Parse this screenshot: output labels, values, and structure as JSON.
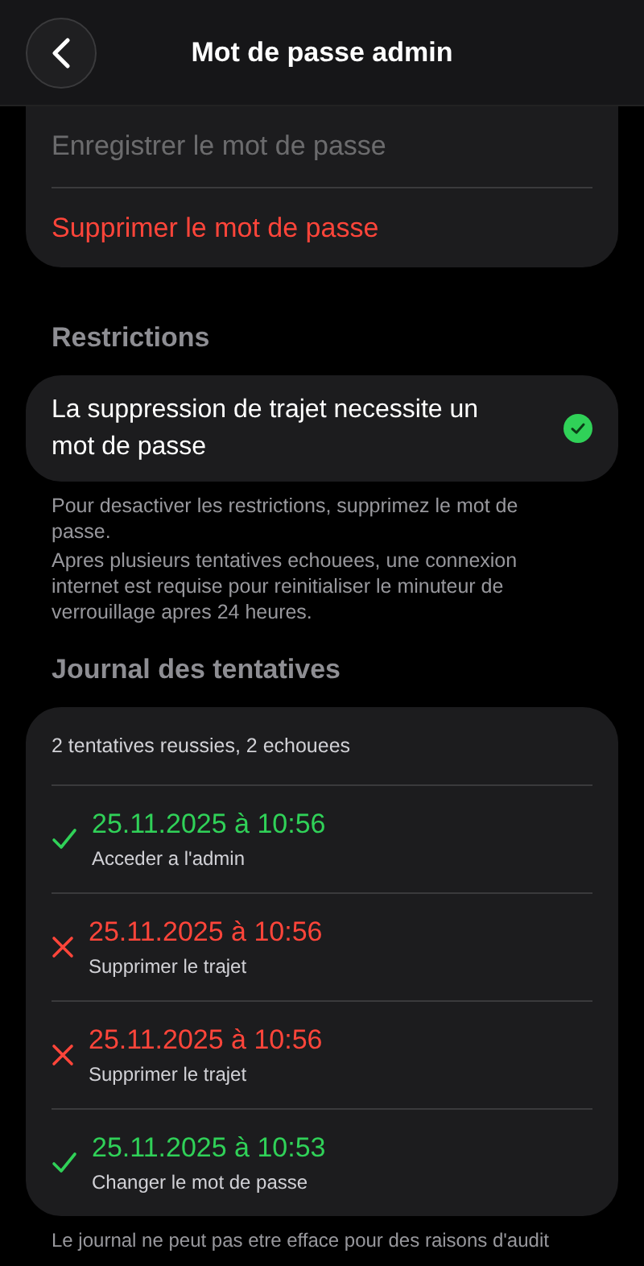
{
  "header": {
    "title": "Mot de passe admin"
  },
  "password_actions": [
    {
      "label": "Enregistrer le mot de passe",
      "disabled": true,
      "kind": "normal"
    },
    {
      "label": "Supprimer le mot de passe",
      "disabled": false,
      "kind": "destructive"
    }
  ],
  "restrictions": {
    "heading": "Restrictions",
    "items": [
      {
        "label": "La suppression de trajet necessite un mot de passe",
        "checked": true
      }
    ],
    "notes": [
      "Pour desactiver les restrictions, supprimez le mot de passe.",
      "Apres plusieurs tentatives echouees, une connexion internet est requise pour reinitialiser le minuteur de verrouillage apres 24 heures."
    ]
  },
  "journal": {
    "heading": "Journal des tentatives",
    "summary": "2 tentatives reussies, 2 echouees",
    "entries": [
      {
        "kind": "success",
        "time": "25.11.2025 à 10:56",
        "action": "Acceder a l'admin"
      },
      {
        "kind": "failure",
        "time": "25.11.2025 à 10:56",
        "action": "Supprimer le trajet"
      },
      {
        "kind": "failure",
        "time": "25.11.2025 à 10:56",
        "action": "Supprimer le trajet"
      },
      {
        "kind": "success",
        "time": "25.11.2025 à 10:53",
        "action": "Changer le mot de passe"
      }
    ],
    "footer": "Le journal ne peut pas etre efface pour des raisons d'audit"
  }
}
